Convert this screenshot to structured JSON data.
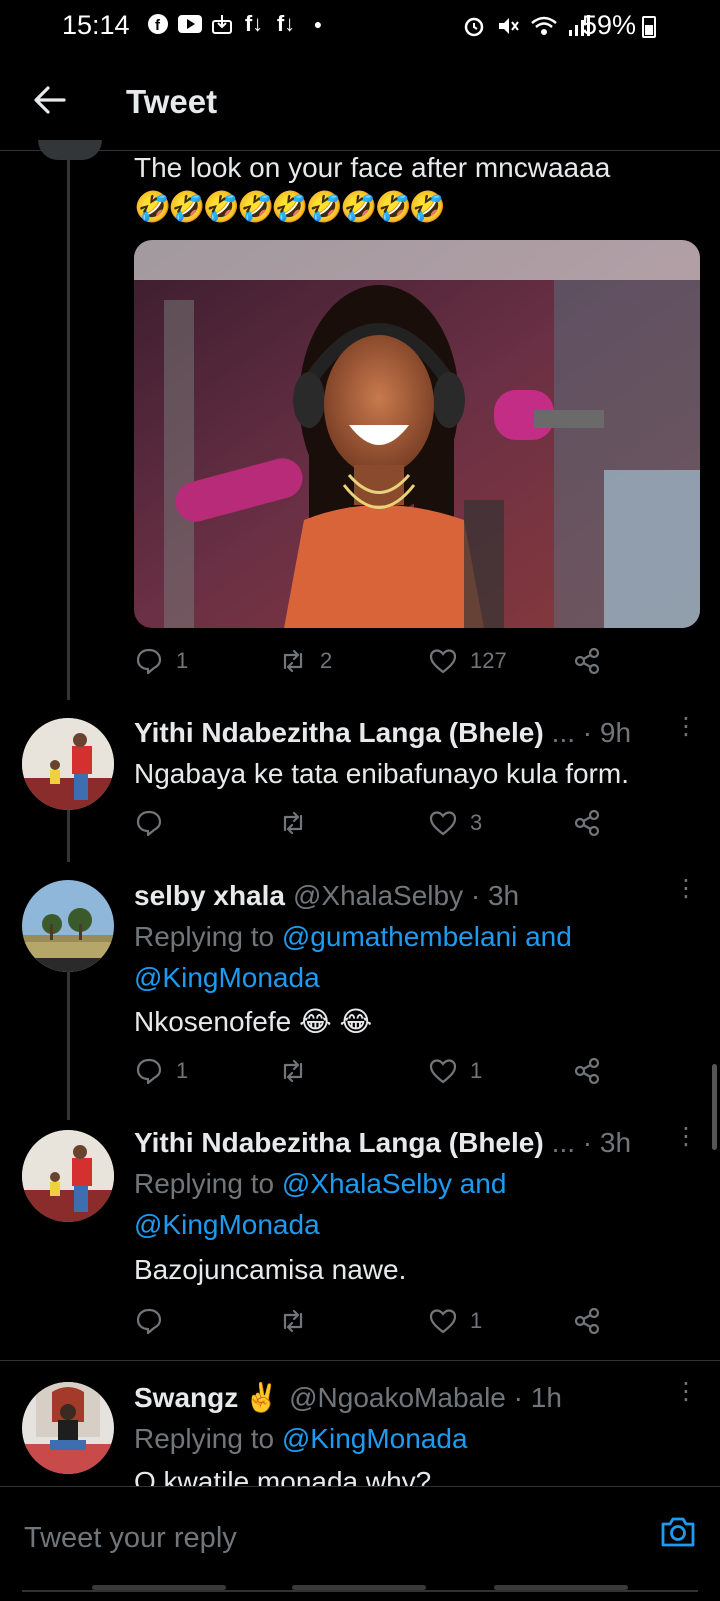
{
  "status_bar": {
    "time": "15:14",
    "left_icons": [
      "facebook-icon",
      "youtube-icon",
      "download-icon",
      "f-download-icon",
      "f-download-icon",
      "dot-icon"
    ],
    "right_icons": [
      "alarm-icon",
      "mute-icon",
      "wifi-icon",
      "signal-icon"
    ],
    "battery": "59%"
  },
  "header": {
    "title": "Tweet"
  },
  "main_tweet": {
    "text": "The look on your face after mncwaaaa",
    "emoji": "🤣🤣🤣🤣🤣🤣🤣🤣🤣",
    "image_alt": "Smiling woman wearing headphones in radio studio",
    "replies": "1",
    "retweets": "2",
    "likes": "127"
  },
  "replies": [
    {
      "name": "Yithi Ndabezitha Langa (Bhele)",
      "suffix": "... · 9h",
      "text": "Ngabaya ke tata enibafunayo kula form.",
      "replies": "",
      "retweets": "",
      "likes": "3"
    },
    {
      "name": "selby xhala",
      "handle": "@XhalaSelby · 3h",
      "replying_prefix": "Replying to ",
      "replying_line1": "@gumathembelani and",
      "replying_line2": "@KingMonada",
      "text": "Nkosenofefe 😂 😂",
      "replies": "1",
      "retweets": "",
      "likes": "1"
    },
    {
      "name": "Yithi Ndabezitha Langa (Bhele)",
      "suffix": "... · 3h",
      "replying_prefix": "Replying to ",
      "replying_line1": "@XhalaSelby and",
      "replying_line2": "@KingMonada",
      "text": "Bazojuncamisa nawe.",
      "replies": "",
      "retweets": "",
      "likes": "1"
    },
    {
      "name": "Swangz",
      "name_emoji": "✌️",
      "handle": "@NgoakoMabale · 1h",
      "replying_prefix": "Replying to ",
      "replying_line1": "@KingMonada",
      "text": "O kwatile monada why?"
    }
  ],
  "reply_bar": {
    "placeholder": "Tweet your reply"
  },
  "colors": {
    "background": "#000000",
    "link": "#1d9bf0",
    "muted": "#71767b",
    "text": "#e7e9ea"
  }
}
